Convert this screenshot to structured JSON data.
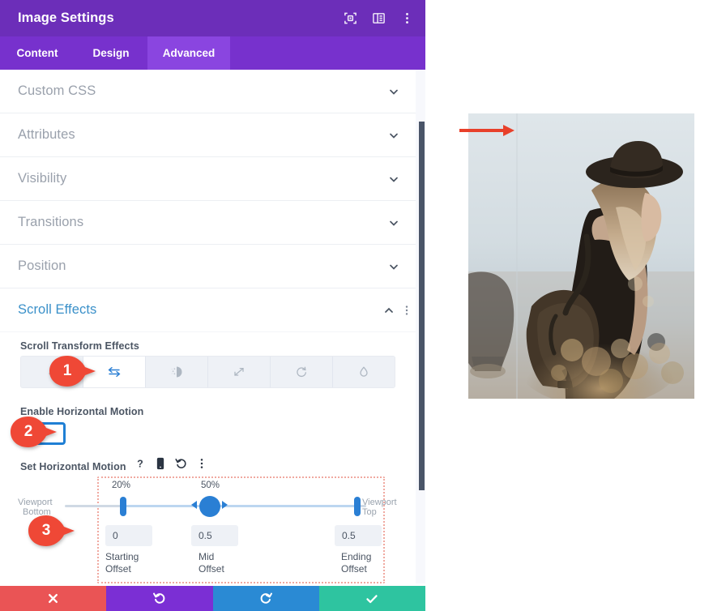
{
  "header": {
    "title": "Image Settings",
    "icons": [
      {
        "name": "focus-target-icon",
        "label": "focus"
      },
      {
        "name": "layout-panel-icon",
        "label": "layout"
      },
      {
        "name": "kebab-menu-icon",
        "label": "more options"
      }
    ]
  },
  "tabs": [
    {
      "label": "Content",
      "active": false
    },
    {
      "label": "Design",
      "active": false
    },
    {
      "label": "Advanced",
      "active": true
    }
  ],
  "accordion": [
    {
      "label": "Custom CSS",
      "expanded": false
    },
    {
      "label": "Attributes",
      "expanded": false
    },
    {
      "label": "Visibility",
      "expanded": false
    },
    {
      "label": "Transitions",
      "expanded": false
    },
    {
      "label": "Position",
      "expanded": false
    }
  ],
  "scroll_effects": {
    "title": "Scroll Effects",
    "expanded": true,
    "transform_label": "Scroll Transform Effects",
    "effects": [
      {
        "name": "vertical-motion-icon",
        "active": false
      },
      {
        "name": "horizontal-motion-icon",
        "active": true
      },
      {
        "name": "fade-in-out-icon",
        "active": false
      },
      {
        "name": "scaling-up-down-icon",
        "active": false
      },
      {
        "name": "rotating-icon",
        "active": false
      },
      {
        "name": "blur-icon",
        "active": false
      }
    ],
    "enable_label": "Enable Horizontal Motion",
    "enabled": false,
    "set_motion_label": "Set Horizontal Motion",
    "motion_tools": [
      {
        "name": "help-icon",
        "glyph": "?"
      },
      {
        "name": "responsive-phone-icon",
        "glyph": "phone"
      },
      {
        "name": "reset-icon",
        "glyph": "undo"
      },
      {
        "name": "kebab-menu-icon",
        "glyph": "dots"
      }
    ],
    "viewport_bottom_label": "Viewport\nBottom",
    "viewport_bottom_line1": "Viewport",
    "viewport_bottom_line2": "Bottom",
    "viewport_top_line1": "Viewport",
    "viewport_top_line2": "Top",
    "markers": {
      "start_pct": "20%",
      "mid_pct": "50%"
    },
    "offsets": [
      {
        "value": "0",
        "label_line1": "Starting",
        "label_line2": "Offset"
      },
      {
        "value": "0.5",
        "label_line1": "Mid",
        "label_line2": "Offset"
      },
      {
        "value": "0.5",
        "label_line1": "Ending",
        "label_line2": "Offset"
      }
    ]
  },
  "bottom_bar": [
    {
      "name": "cancel-button",
      "icon": "close-icon",
      "color": "#ea5455"
    },
    {
      "name": "undo-button",
      "icon": "undo-icon",
      "color": "#7b2fd4"
    },
    {
      "name": "redo-button",
      "icon": "redo-icon",
      "color": "#2a8ad4"
    },
    {
      "name": "save-button",
      "icon": "checkmark-icon",
      "color": "#2ec4a0"
    }
  ],
  "callouts": [
    {
      "number": "1"
    },
    {
      "number": "2"
    },
    {
      "number": "3"
    }
  ],
  "preview": {
    "arrow_name": "red-direction-arrow",
    "image_alt": "Woman with hat and backpack"
  },
  "colors": {
    "header_purple": "#6c2eb9",
    "tab_purple": "#7731cd",
    "tab_active_purple": "#8a45e0",
    "accent_blue": "#2a7fd4",
    "section_blue": "#3a90c9",
    "callout_red": "#ef4836",
    "dotted_pink": "#f0a9a0"
  }
}
